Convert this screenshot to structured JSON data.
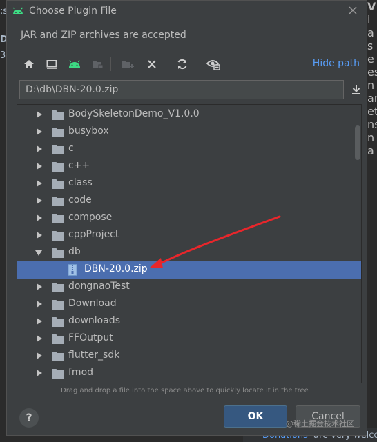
{
  "background": {
    "left_fragments": [
      ":s",
      "D",
      "3"
    ],
    "right_fragments": [
      "V",
      "i",
      "a",
      "s",
      "e",
      "es",
      "n",
      "an",
      "et",
      "ns",
      "n",
      "a"
    ],
    "footer_link": "Donations",
    "footer_rest": "are very welco"
  },
  "dialog": {
    "title": "Choose Plugin File",
    "subtitle": "JAR and ZIP archives are accepted",
    "toolbar": {
      "icons": [
        "home-icon",
        "desktop-icon",
        "android-icon",
        "project-folder-icon",
        "new-folder-icon",
        "delete-icon",
        "refresh-icon",
        "show-hidden-icon"
      ],
      "hide_path_label": "Hide path"
    },
    "path_value": "D:\\db\\DBN-20.0.zip",
    "tree": [
      {
        "label": "BodySkeletonDemo_V1.0.0",
        "type": "folder",
        "expanded": false
      },
      {
        "label": "busybox",
        "type": "folder",
        "expanded": false
      },
      {
        "label": "c",
        "type": "folder",
        "expanded": false
      },
      {
        "label": "c++",
        "type": "folder",
        "expanded": false
      },
      {
        "label": "class",
        "type": "folder",
        "expanded": false
      },
      {
        "label": "code",
        "type": "folder",
        "expanded": false
      },
      {
        "label": "compose",
        "type": "folder",
        "expanded": false
      },
      {
        "label": "cppProject",
        "type": "folder",
        "expanded": false
      },
      {
        "label": "db",
        "type": "folder",
        "expanded": true
      },
      {
        "label": "DBN-20.0.zip",
        "type": "zip",
        "selected": true
      },
      {
        "label": "dongnaoTest",
        "type": "folder",
        "expanded": false
      },
      {
        "label": "Download",
        "type": "folder",
        "expanded": false
      },
      {
        "label": "downloads",
        "type": "folder",
        "expanded": false
      },
      {
        "label": "FFOutput",
        "type": "folder",
        "expanded": false
      },
      {
        "label": "flutter_sdk",
        "type": "folder",
        "expanded": false
      },
      {
        "label": "fmod",
        "type": "folder",
        "expanded": false
      }
    ],
    "hint": "Drag and drop a file into the space above to quickly locate it in the tree",
    "help_label": "?",
    "ok_label": "OK",
    "cancel_label": "Cancel"
  },
  "watermark": "@稀土掘金技术社区",
  "colors": {
    "accent": "#589df6",
    "selection": "#4b6eaf",
    "ok_button": "#365880",
    "android_green": "#3ddc84",
    "annotation_arrow": "#e8262b"
  }
}
